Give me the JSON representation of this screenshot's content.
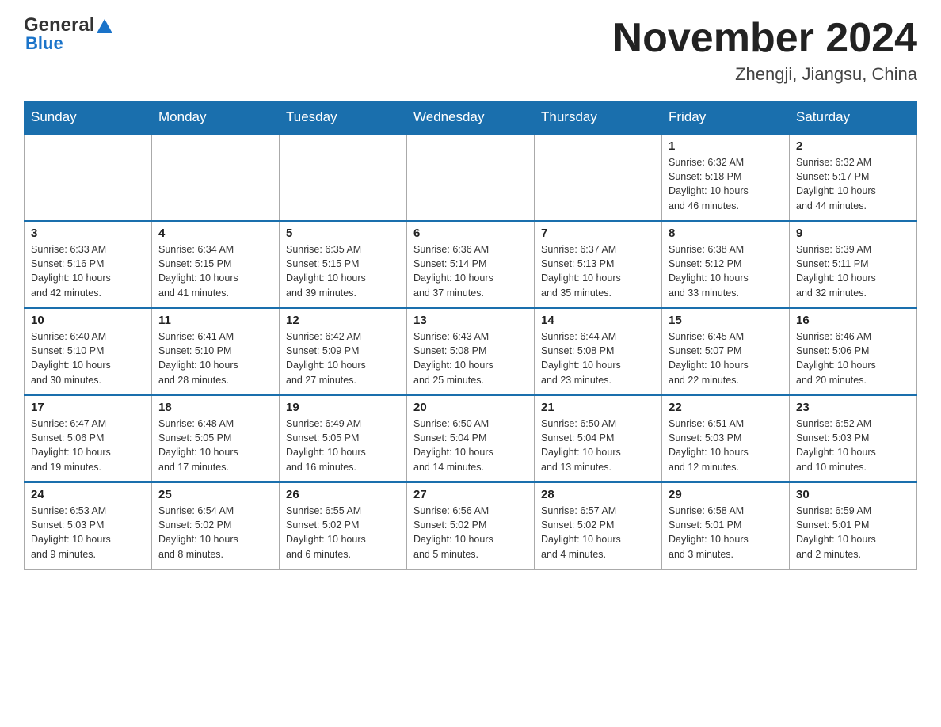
{
  "header": {
    "logo_general": "General",
    "logo_blue": "Blue",
    "month_title": "November 2024",
    "location": "Zhengji, Jiangsu, China"
  },
  "days_of_week": [
    "Sunday",
    "Monday",
    "Tuesday",
    "Wednesday",
    "Thursday",
    "Friday",
    "Saturday"
  ],
  "weeks": [
    [
      {
        "day": "",
        "info": ""
      },
      {
        "day": "",
        "info": ""
      },
      {
        "day": "",
        "info": ""
      },
      {
        "day": "",
        "info": ""
      },
      {
        "day": "",
        "info": ""
      },
      {
        "day": "1",
        "info": "Sunrise: 6:32 AM\nSunset: 5:18 PM\nDaylight: 10 hours\nand 46 minutes."
      },
      {
        "day": "2",
        "info": "Sunrise: 6:32 AM\nSunset: 5:17 PM\nDaylight: 10 hours\nand 44 minutes."
      }
    ],
    [
      {
        "day": "3",
        "info": "Sunrise: 6:33 AM\nSunset: 5:16 PM\nDaylight: 10 hours\nand 42 minutes."
      },
      {
        "day": "4",
        "info": "Sunrise: 6:34 AM\nSunset: 5:15 PM\nDaylight: 10 hours\nand 41 minutes."
      },
      {
        "day": "5",
        "info": "Sunrise: 6:35 AM\nSunset: 5:15 PM\nDaylight: 10 hours\nand 39 minutes."
      },
      {
        "day": "6",
        "info": "Sunrise: 6:36 AM\nSunset: 5:14 PM\nDaylight: 10 hours\nand 37 minutes."
      },
      {
        "day": "7",
        "info": "Sunrise: 6:37 AM\nSunset: 5:13 PM\nDaylight: 10 hours\nand 35 minutes."
      },
      {
        "day": "8",
        "info": "Sunrise: 6:38 AM\nSunset: 5:12 PM\nDaylight: 10 hours\nand 33 minutes."
      },
      {
        "day": "9",
        "info": "Sunrise: 6:39 AM\nSunset: 5:11 PM\nDaylight: 10 hours\nand 32 minutes."
      }
    ],
    [
      {
        "day": "10",
        "info": "Sunrise: 6:40 AM\nSunset: 5:10 PM\nDaylight: 10 hours\nand 30 minutes."
      },
      {
        "day": "11",
        "info": "Sunrise: 6:41 AM\nSunset: 5:10 PM\nDaylight: 10 hours\nand 28 minutes."
      },
      {
        "day": "12",
        "info": "Sunrise: 6:42 AM\nSunset: 5:09 PM\nDaylight: 10 hours\nand 27 minutes."
      },
      {
        "day": "13",
        "info": "Sunrise: 6:43 AM\nSunset: 5:08 PM\nDaylight: 10 hours\nand 25 minutes."
      },
      {
        "day": "14",
        "info": "Sunrise: 6:44 AM\nSunset: 5:08 PM\nDaylight: 10 hours\nand 23 minutes."
      },
      {
        "day": "15",
        "info": "Sunrise: 6:45 AM\nSunset: 5:07 PM\nDaylight: 10 hours\nand 22 minutes."
      },
      {
        "day": "16",
        "info": "Sunrise: 6:46 AM\nSunset: 5:06 PM\nDaylight: 10 hours\nand 20 minutes."
      }
    ],
    [
      {
        "day": "17",
        "info": "Sunrise: 6:47 AM\nSunset: 5:06 PM\nDaylight: 10 hours\nand 19 minutes."
      },
      {
        "day": "18",
        "info": "Sunrise: 6:48 AM\nSunset: 5:05 PM\nDaylight: 10 hours\nand 17 minutes."
      },
      {
        "day": "19",
        "info": "Sunrise: 6:49 AM\nSunset: 5:05 PM\nDaylight: 10 hours\nand 16 minutes."
      },
      {
        "day": "20",
        "info": "Sunrise: 6:50 AM\nSunset: 5:04 PM\nDaylight: 10 hours\nand 14 minutes."
      },
      {
        "day": "21",
        "info": "Sunrise: 6:50 AM\nSunset: 5:04 PM\nDaylight: 10 hours\nand 13 minutes."
      },
      {
        "day": "22",
        "info": "Sunrise: 6:51 AM\nSunset: 5:03 PM\nDaylight: 10 hours\nand 12 minutes."
      },
      {
        "day": "23",
        "info": "Sunrise: 6:52 AM\nSunset: 5:03 PM\nDaylight: 10 hours\nand 10 minutes."
      }
    ],
    [
      {
        "day": "24",
        "info": "Sunrise: 6:53 AM\nSunset: 5:03 PM\nDaylight: 10 hours\nand 9 minutes."
      },
      {
        "day": "25",
        "info": "Sunrise: 6:54 AM\nSunset: 5:02 PM\nDaylight: 10 hours\nand 8 minutes."
      },
      {
        "day": "26",
        "info": "Sunrise: 6:55 AM\nSunset: 5:02 PM\nDaylight: 10 hours\nand 6 minutes."
      },
      {
        "day": "27",
        "info": "Sunrise: 6:56 AM\nSunset: 5:02 PM\nDaylight: 10 hours\nand 5 minutes."
      },
      {
        "day": "28",
        "info": "Sunrise: 6:57 AM\nSunset: 5:02 PM\nDaylight: 10 hours\nand 4 minutes."
      },
      {
        "day": "29",
        "info": "Sunrise: 6:58 AM\nSunset: 5:01 PM\nDaylight: 10 hours\nand 3 minutes."
      },
      {
        "day": "30",
        "info": "Sunrise: 6:59 AM\nSunset: 5:01 PM\nDaylight: 10 hours\nand 2 minutes."
      }
    ]
  ]
}
